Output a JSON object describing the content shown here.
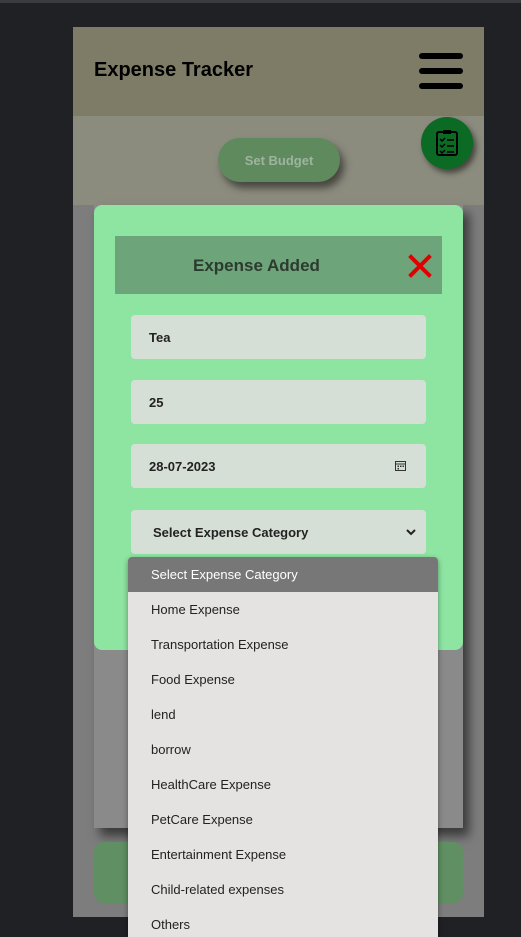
{
  "app": {
    "title": "Expense Tracker"
  },
  "actions": {
    "set_budget": "Set Budget"
  },
  "modal": {
    "title": "Expense Added",
    "fields": {
      "name": "Tea",
      "amount": "25",
      "date": "28-07-2023",
      "category": "Select Expense Category"
    }
  },
  "dropdown": {
    "options": [
      "Select Expense Category",
      "Home Expense",
      "Transportation Expense",
      "Food Expense",
      "lend",
      "borrow",
      "HealthCare Expense",
      "PetCare Expense",
      "Entertainment Expense",
      "Child-related expenses",
      "Others"
    ]
  },
  "colors": {
    "modal_bg": "#8ee5a2",
    "header_bg": "#6ea47a",
    "close_red": "#e10000",
    "fab_green": "#0b6a23"
  }
}
